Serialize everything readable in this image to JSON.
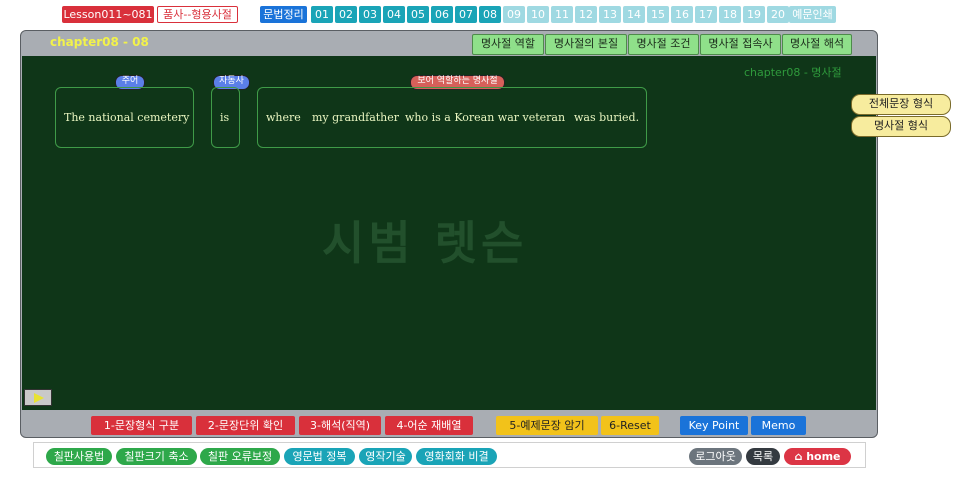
{
  "nav": {
    "lesson": "Lesson011~081",
    "pos": "품사--형용사절",
    "grammar": "문법정리",
    "numbers_on": [
      "01",
      "02",
      "03",
      "04",
      "05",
      "06",
      "07",
      "08"
    ],
    "numbers_off": [
      "09",
      "10",
      "11",
      "12",
      "13",
      "14",
      "15",
      "16",
      "17",
      "18",
      "19",
      "20"
    ],
    "print": "예문인쇄"
  },
  "board": {
    "title": "chapter08 - 08",
    "tabs": [
      "명사절 역할",
      "명사절의 본질",
      "명사절 조건",
      "명사절 접속사",
      "명사절 해석"
    ],
    "chapter_label": "chapter08 - 명사절",
    "watermark": "시범 렛슨",
    "tags": {
      "subject": "주어",
      "verb": "자동사",
      "complement": "보어 역할하는 명사절"
    },
    "sentence": {
      "subject": "The national cemetery",
      "verb": "is",
      "clause": [
        "where",
        "my grandfather",
        "who is a Korean war veteran",
        "was buried."
      ]
    },
    "side_buttons": [
      "전체문장 형식",
      "명사절 형식"
    ]
  },
  "controls": [
    "1-문장형식 구분",
    "2-문장단위 확인",
    "3-해석(직역)",
    "4-어순 재배열",
    "5-예제문장 암기",
    "6-Reset",
    "Key Point",
    "Memo"
  ],
  "footer": {
    "left": [
      "칠판사용법",
      "칠판크기 축소",
      "칠판 오류보정",
      "영문법 정복",
      "영작기술",
      "영화회화 비결"
    ],
    "logout": "로그아웃",
    "list": "목록",
    "home": "home"
  },
  "colors": {
    "board": "#0f3618",
    "accent_red": "#d9303b",
    "accent_blue": "#1a73d9",
    "teal": "#1aa4b7"
  }
}
